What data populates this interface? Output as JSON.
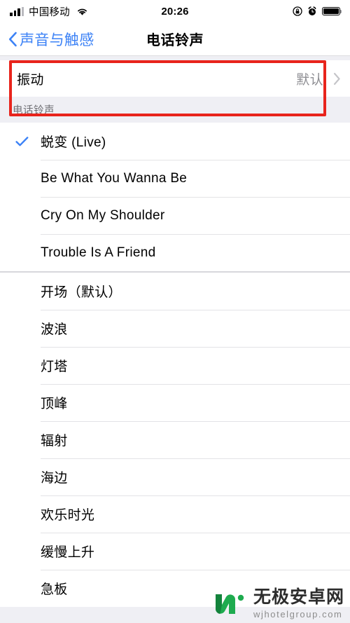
{
  "status_bar": {
    "carrier": "中国移动",
    "time": "20:26",
    "signal_icon": "signal-bars-icon",
    "wifi_icon": "wifi-icon",
    "rotation_lock_icon": "rotation-lock-icon",
    "alarm_icon": "alarm-clock-icon",
    "battery_icon": "battery-full-icon"
  },
  "nav": {
    "back_label": "声音与触感",
    "back_icon": "chevron-left-icon",
    "title": "电话铃声"
  },
  "vibration": {
    "label": "振动",
    "value": "默认",
    "chevron_icon": "chevron-right-icon"
  },
  "section": {
    "header": "电话铃声"
  },
  "custom_tones": [
    {
      "label": "蜕变 (Live)",
      "selected": true
    },
    {
      "label": "Be What You Wanna Be",
      "selected": false
    },
    {
      "label": "Cry On My Shoulder",
      "selected": false
    },
    {
      "label": "Trouble Is A Friend",
      "selected": false
    }
  ],
  "system_tones": [
    {
      "label": "开场（默认）",
      "selected": false
    },
    {
      "label": "波浪",
      "selected": false
    },
    {
      "label": "灯塔",
      "selected": false
    },
    {
      "label": "顶峰",
      "selected": false
    },
    {
      "label": "辐射",
      "selected": false
    },
    {
      "label": "海边",
      "selected": false
    },
    {
      "label": "欢乐时光",
      "selected": false
    },
    {
      "label": "缓慢上升",
      "selected": false
    },
    {
      "label": "急板",
      "selected": false
    }
  ],
  "watermark": {
    "title": "无极安卓网",
    "url": "wjhotelgroup.com",
    "logo_icon": "w-logo-icon"
  },
  "colors": {
    "accent_blue": "#3c82f6",
    "annotation_red": "#e8241c",
    "group_background": "#efeff4",
    "secondary_text": "#8e8e93",
    "watermark_green": "#1eab4f"
  }
}
